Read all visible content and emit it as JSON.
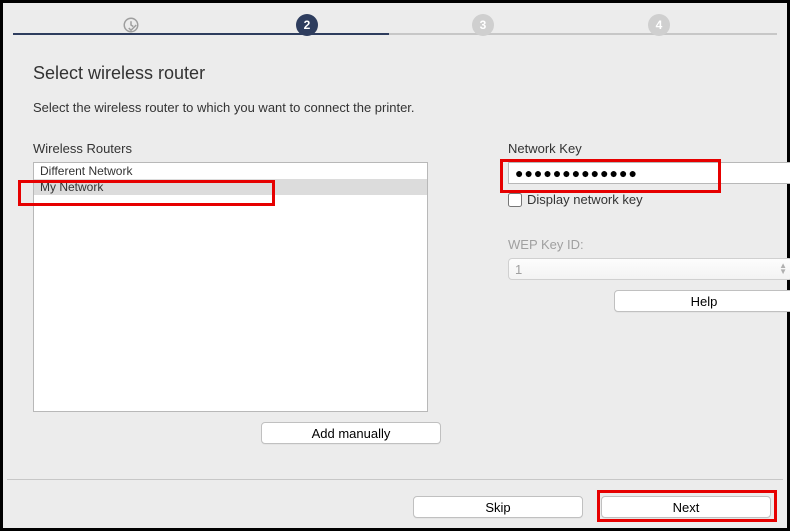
{
  "steps": {
    "s2": "2",
    "s3": "3",
    "s4": "4"
  },
  "title": "Select wireless router",
  "subtitle": "Select the wireless router to which you want to connect the printer.",
  "left": {
    "label": "Wireless Routers",
    "routers": [
      "Different Network",
      "My Network"
    ],
    "add_manually": "Add manually"
  },
  "right": {
    "nk_label": "Network Key",
    "nk_value": "●●●●●●●●●●●●●",
    "display_key": "Display network key",
    "wep_label": "WEP Key ID:",
    "wep_value": "1",
    "help": "Help"
  },
  "footer": {
    "skip": "Skip",
    "next": "Next"
  }
}
